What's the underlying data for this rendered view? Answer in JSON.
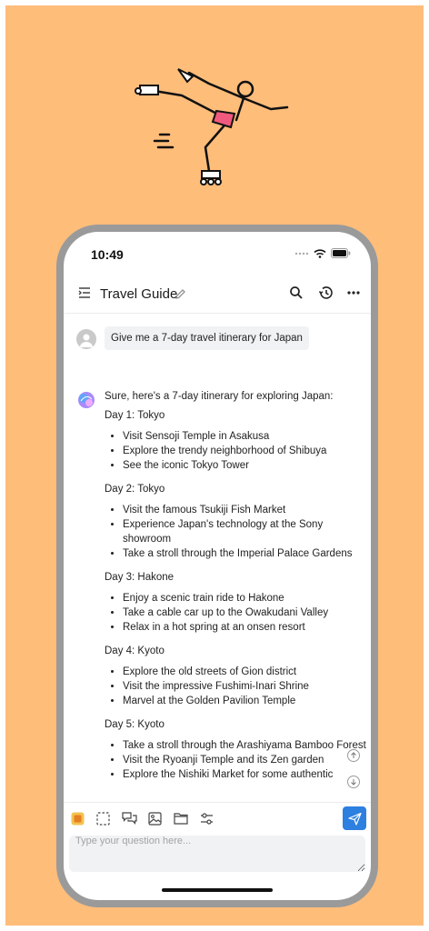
{
  "status_bar": {
    "time": "10:49"
  },
  "header": {
    "title": "Travel Guide",
    "icons": [
      "menu-icon",
      "pencil-icon",
      "search-icon",
      "history-icon",
      "more-icon"
    ]
  },
  "conversation": {
    "user_message": "Give me a 7-day travel itinerary for Japan",
    "assistant_intro": "Sure, here's a 7-day itinerary for exploring Japan:",
    "days": [
      {
        "title": "Day 1: Tokyo",
        "items": [
          "Visit Sensoji Temple in Asakusa",
          "Explore the trendy neighborhood of Shibuya",
          "See the iconic Tokyo Tower"
        ]
      },
      {
        "title": "Day 2: Tokyo",
        "items": [
          "Visit the famous Tsukiji Fish Market",
          "Experience Japan's technology at the Sony showroom",
          "Take a stroll through the Imperial Palace Gardens"
        ]
      },
      {
        "title": "Day 3: Hakone",
        "items": [
          "Enjoy a scenic train ride to Hakone",
          "Take a cable car up to the Owakudani Valley",
          "Relax in a hot spring at an onsen resort"
        ]
      },
      {
        "title": "Day 4: Kyoto",
        "items": [
          "Explore the old streets of Gion district",
          "Visit the impressive Fushimi-Inari Shrine",
          "Marvel at the Golden Pavilion Temple"
        ]
      },
      {
        "title": "Day 5: Kyoto",
        "items": [
          "Take a stroll through the Arashiyama Bamboo Forest",
          "Visit the Ryoanji Temple and its Zen garden",
          "Explore the Nishiki Market for some authentic"
        ]
      }
    ]
  },
  "toolbar": {
    "icons": [
      "app-icon",
      "screenshot-select-icon",
      "chat-bubbles-icon",
      "image-icon",
      "folder-icon",
      "settings-sliders-icon"
    ]
  },
  "composer": {
    "placeholder": "Type your question here..."
  },
  "colors": {
    "page_bg": "#ffbd7a",
    "phone_frame": "#9a9a9a",
    "accent": "#2d7fe0"
  }
}
